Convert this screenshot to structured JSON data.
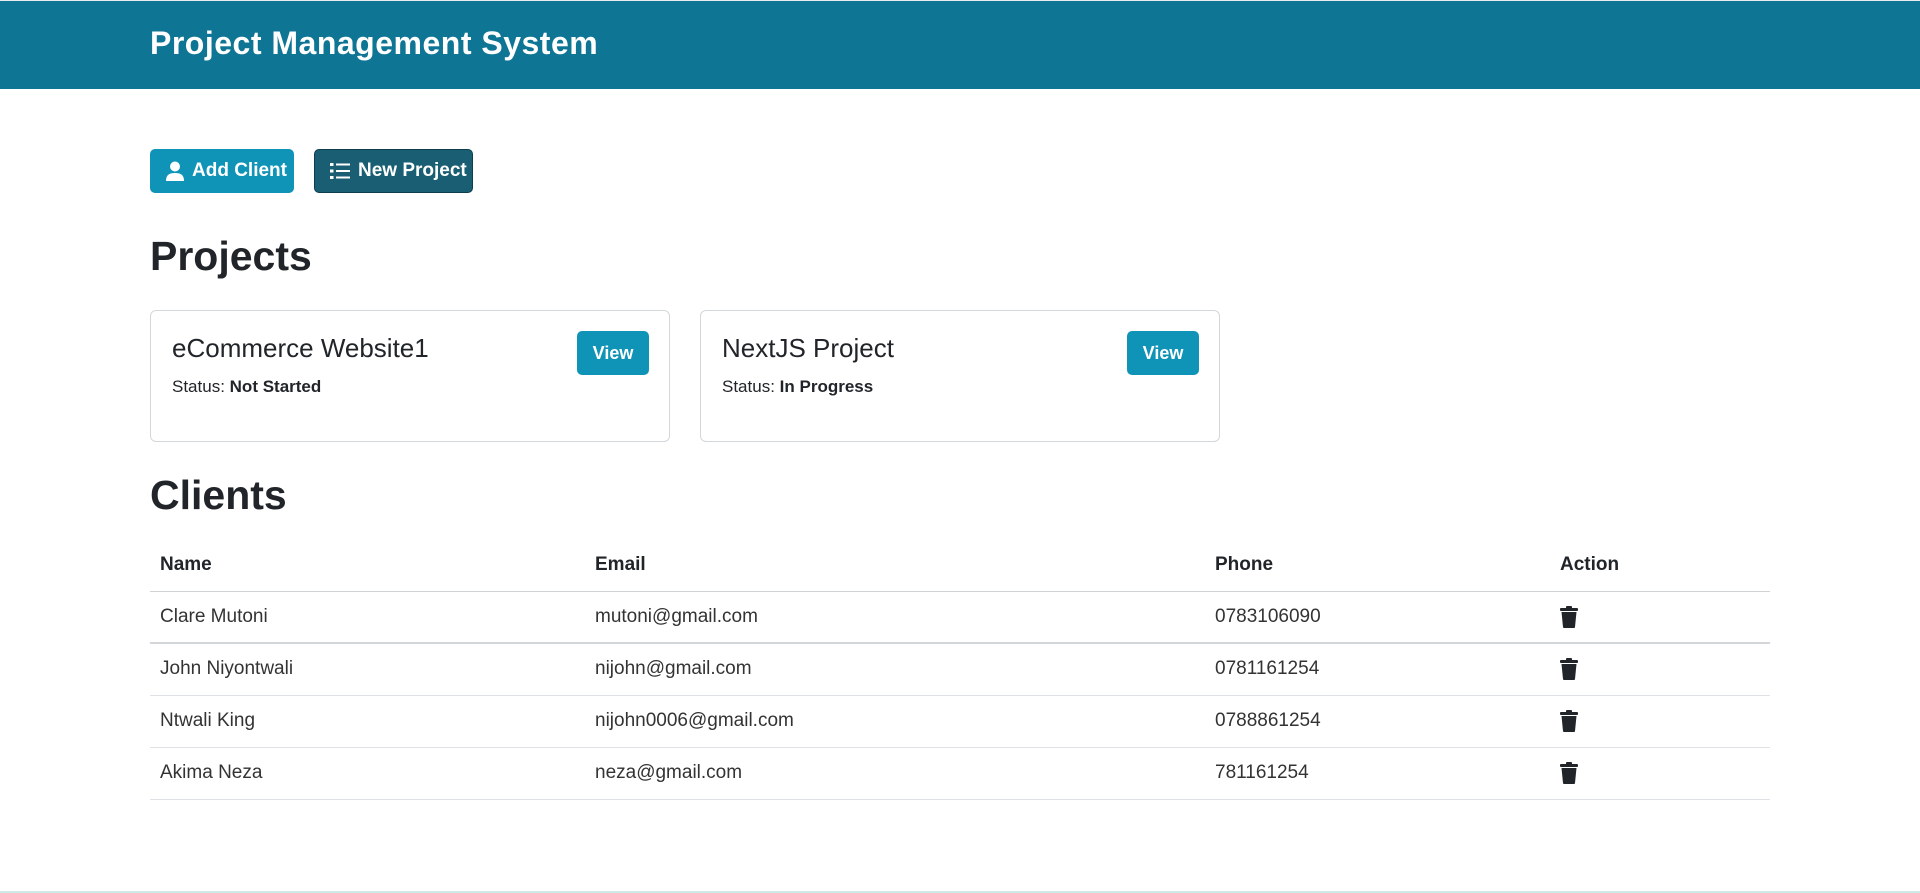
{
  "header": {
    "title": "Project Management System"
  },
  "toolbar": {
    "add_client_label": "Add Client",
    "new_project_label": "New Project"
  },
  "projects": {
    "title": "Projects",
    "status_label": "Status:",
    "view_label": "View",
    "items": [
      {
        "name": "eCommerce Website1",
        "status": "Not Started"
      },
      {
        "name": "NextJS Project",
        "status": "In Progress"
      }
    ]
  },
  "clients": {
    "title": "Clients",
    "columns": [
      "Name",
      "Email",
      "Phone",
      "Action"
    ],
    "rows": [
      {
        "name": "Clare Mutoni",
        "email": "mutoni@gmail.com",
        "phone": "0783106090"
      },
      {
        "name": "John Niyontwali",
        "email": "nijohn@gmail.com",
        "phone": "0781161254"
      },
      {
        "name": "Ntwali King",
        "email": "nijohn0006@gmail.com",
        "phone": "0788861254"
      },
      {
        "name": "Akima Neza",
        "email": "neza@gmail.com",
        "phone": "781161254"
      }
    ]
  },
  "colors": {
    "navbar": "#0f7594",
    "primary_button": "#0f94b7",
    "secondary_button": "#195e72"
  },
  "icons": {
    "add_client": "user-icon",
    "new_project": "list-icon",
    "delete": "trash-icon"
  }
}
